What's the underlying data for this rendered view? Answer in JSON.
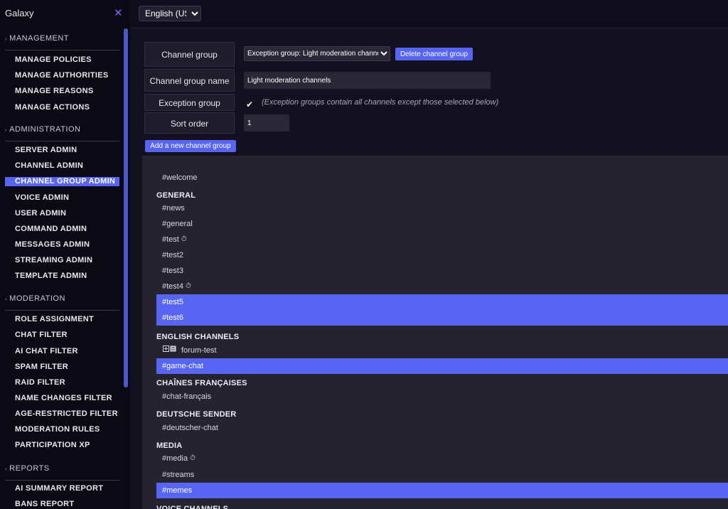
{
  "sidebar": {
    "title": "Galaxy",
    "close_glyph": "✕",
    "sections": [
      {
        "label": "MANAGEMENT",
        "items": [
          "MANAGE POLICIES",
          "MANAGE AUTHORITIES",
          "MANAGE REASONS",
          "MANAGE ACTIONS"
        ]
      },
      {
        "label": "ADMINISTRATION",
        "items": [
          "SERVER ADMIN",
          "CHANNEL ADMIN",
          "CHANNEL GROUP ADMIN",
          "VOICE ADMIN",
          "USER ADMIN",
          "COMMAND ADMIN",
          "MESSAGES ADMIN",
          "STREAMING ADMIN",
          "TEMPLATE ADMIN"
        ]
      },
      {
        "label": "MODERATION",
        "items": [
          "ROLE ASSIGNMENT",
          "CHAT FILTER",
          "AI CHAT FILTER",
          "SPAM FILTER",
          "RAID FILTER",
          "NAME CHANGES FILTER",
          "AGE-RESTRICTED FILTER",
          "MODERATION RULES",
          "PARTICIPATION XP"
        ]
      },
      {
        "label": "REPORTS",
        "items": [
          "AI SUMMARY REPORT",
          "BANS REPORT"
        ]
      }
    ],
    "active_item": "CHANNEL GROUP ADMIN"
  },
  "topbar": {
    "language": "English (US)"
  },
  "form": {
    "channel_group_label": "Channel group",
    "channel_group_value": "Exception group: Light moderation channels",
    "delete_button": "Delete channel group",
    "name_label": "Channel group name",
    "name_value": "Light moderation channels",
    "exception_label": "Exception group",
    "exception_checked": true,
    "exception_note": "(Exception groups contain all channels except those selected below)",
    "sort_label": "Sort order",
    "sort_value": "1",
    "add_button": "Add a new channel group"
  },
  "channel_list": [
    {
      "kind": "channel",
      "name": "#welcome",
      "selected": false
    },
    {
      "kind": "category",
      "name": "GENERAL"
    },
    {
      "kind": "channel",
      "name": "#news",
      "selected": false
    },
    {
      "kind": "channel",
      "name": "#general",
      "selected": false
    },
    {
      "kind": "channel",
      "name": "#test",
      "selected": false,
      "icon": "timer-icon"
    },
    {
      "kind": "channel",
      "name": "#test2",
      "selected": false
    },
    {
      "kind": "channel",
      "name": "#test3",
      "selected": false
    },
    {
      "kind": "channel",
      "name": "#test4",
      "selected": false,
      "icon": "timer-icon"
    },
    {
      "kind": "channel",
      "name": "#test5",
      "selected": true
    },
    {
      "kind": "channel",
      "name": "#test6",
      "selected": true
    },
    {
      "kind": "category",
      "name": "ENGLISH CHANNELS"
    },
    {
      "kind": "channel",
      "name": "forum-test",
      "selected": false,
      "icon": "forum-icon"
    },
    {
      "kind": "channel",
      "name": "#game-chat",
      "selected": true
    },
    {
      "kind": "category",
      "name": "CHAÎNES FRANÇAISES"
    },
    {
      "kind": "channel",
      "name": "#chat-français",
      "selected": false
    },
    {
      "kind": "category",
      "name": "DEUTSCHE SENDER"
    },
    {
      "kind": "channel",
      "name": "#deutscher-chat",
      "selected": false
    },
    {
      "kind": "category",
      "name": "MEDIA"
    },
    {
      "kind": "channel",
      "name": "#media",
      "selected": false,
      "icon": "timer-icon"
    },
    {
      "kind": "channel",
      "name": "#streams",
      "selected": false
    },
    {
      "kind": "channel",
      "name": "#memes",
      "selected": true
    },
    {
      "kind": "category",
      "name": "VOICE CHANNELS"
    }
  ],
  "colors": {
    "accent": "#5865f2",
    "panel": "#25232f",
    "background": "#0f0c1c"
  }
}
